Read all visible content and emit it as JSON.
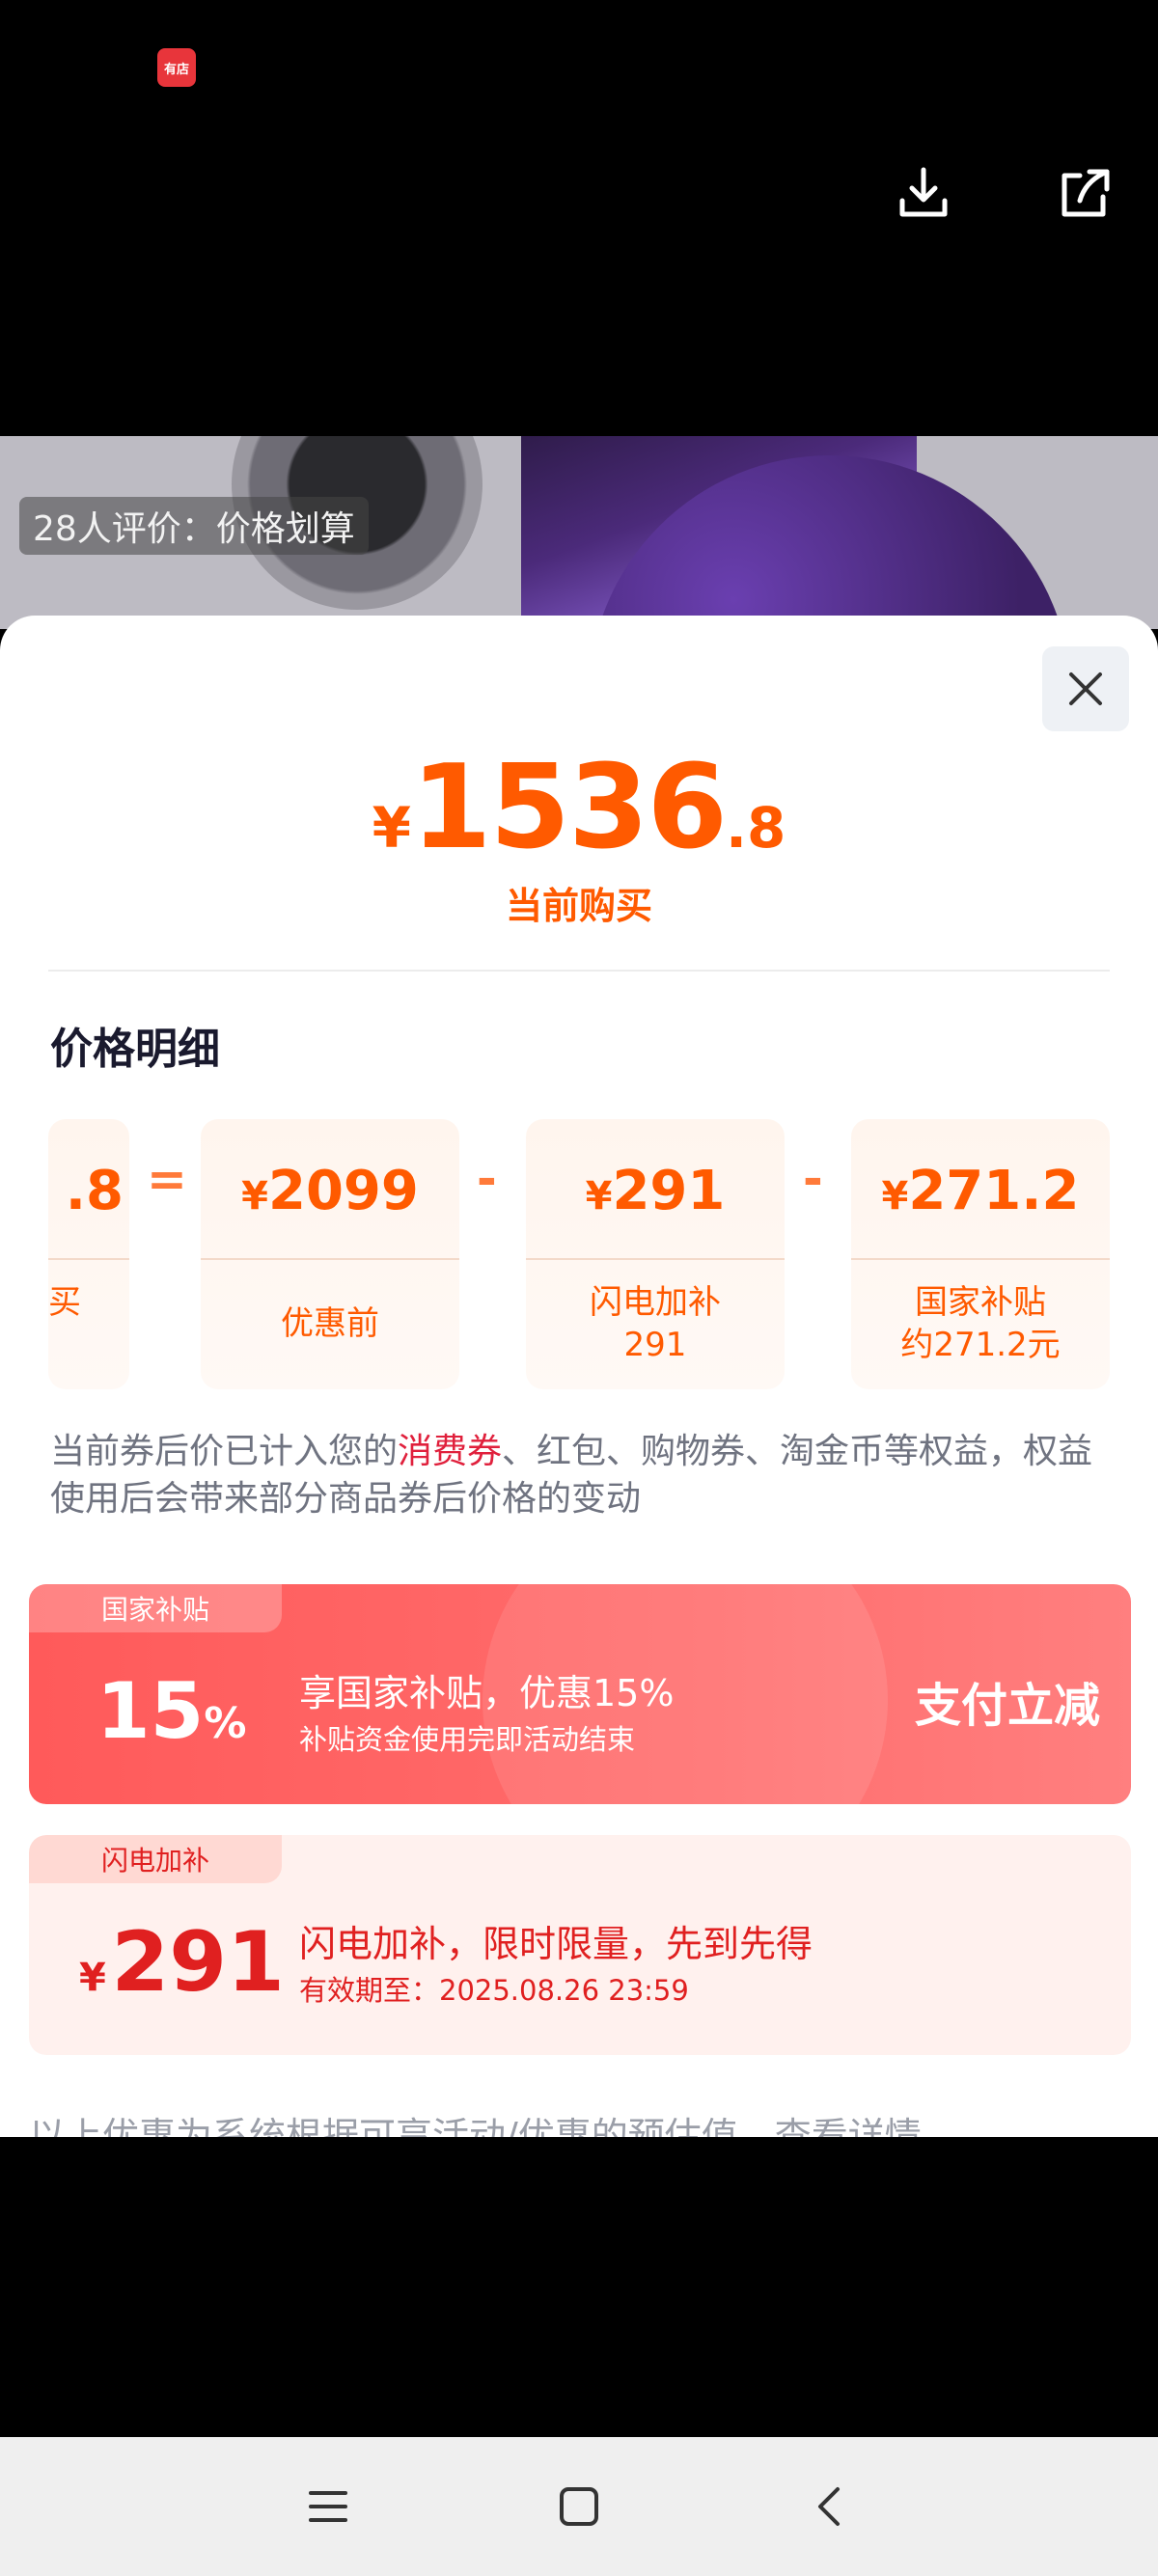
{
  "app": {
    "logo_text": "有店"
  },
  "product": {
    "review_badge": "28人评价：价格划算"
  },
  "sheet": {
    "price": {
      "symbol": "¥",
      "integer": "1536",
      "decimal": ".8",
      "label": "当前购买"
    },
    "detail_title": "价格明细",
    "breakdown": {
      "partial": {
        "value": ".8",
        "label": "买"
      },
      "ops": [
        "=",
        "-",
        "-"
      ],
      "items": [
        {
          "symbol": "¥",
          "value": "2099",
          "label": "优惠前"
        },
        {
          "symbol": "¥",
          "value": "291",
          "label_line1": "闪电加补",
          "label_line2": "291"
        },
        {
          "symbol": "¥",
          "value": "271.2",
          "label_line1": "国家补贴",
          "label_line2": "约271.2元"
        }
      ]
    },
    "notice": {
      "before": "当前券后价已计入您的",
      "highlight": "消费券",
      "after": "、红包、购物券、淘金币等权益，权益使用后会带来部分商品券后价格的变动"
    },
    "subsidy_card": {
      "tab": "国家补贴",
      "percent_number": "15",
      "percent_sign": "%",
      "title": "享国家补贴，优惠15%",
      "subtitle": "补贴资金使用完即活动结束",
      "action": "支付立减"
    },
    "flash_card": {
      "tab": "闪电加补",
      "symbol": "¥",
      "amount": "291",
      "title": "闪电加补，限时限量，先到先得",
      "validity": "有效期至：2025.08.26 23:59"
    },
    "cut_text": "以上优惠为系统根据可享活动/优惠的预估值，查看详情"
  },
  "icons": {
    "download": "download-icon",
    "share": "share-icon",
    "close": "close-icon",
    "menu": "menu-icon",
    "home": "home-icon",
    "back": "back-icon"
  },
  "colors": {
    "accent": "#ff5a00",
    "red": "#e02020",
    "subsidy": "#ff6b6b"
  }
}
